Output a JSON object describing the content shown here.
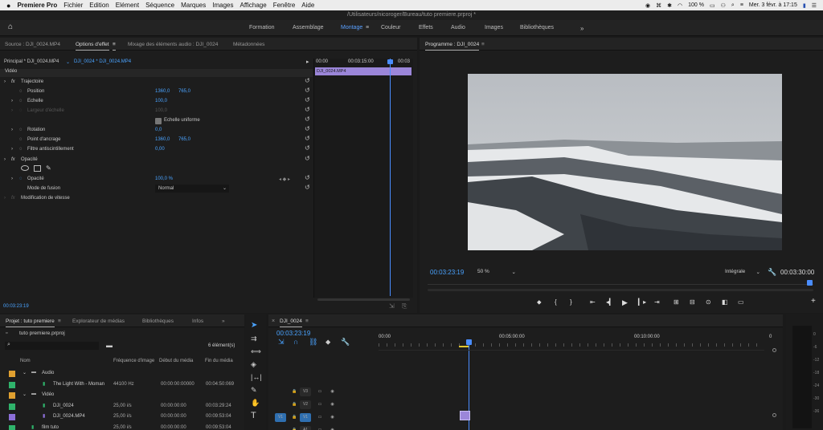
{
  "menubar": {
    "app_name": "Premiere Pro",
    "items": [
      "Fichier",
      "Edition",
      "Elément",
      "Séquence",
      "Marques",
      "Images",
      "Affichage",
      "Fenêtre",
      "Aide"
    ],
    "battery": "100 %",
    "clock": "Mer. 3 févr. à 17:15"
  },
  "window_title": "/Utilisateurs/nicoroger/Bureau/tuto premiere.prproj *",
  "workspaces": [
    "Formation",
    "Assemblage",
    "Montage",
    "Couleur",
    "Effets",
    "Audio",
    "Images",
    "Bibliothèques"
  ],
  "source_panel": {
    "tabs": [
      "Source : DJI_0024.MP4",
      "Options d'effet",
      "Mixage des éléments audio : DJI_0024",
      "Métadonnées"
    ],
    "clip_path": "Principal * DJI_0024.MP4",
    "clip_link": "DJI_0024 * DJI_0024.MP4",
    "mini_tl_start": "00:00",
    "mini_tl_mid": "00:03:15:00",
    "mini_tl_end": "00:03",
    "mini_clip": "DJI_0024.MP4",
    "section_video": "Vidéo",
    "motion": "Trajectoire",
    "position_label": "Position",
    "position_x": "1360,0",
    "position_y": "765,0",
    "scale_label": "Echelle",
    "scale_val": "100,0",
    "scale_width_label": "Largeur d'échelle",
    "scale_width_val": "100,0",
    "uniform_scale": "Echelle uniforme",
    "rotation_label": "Rotation",
    "rotation_val": "0,0",
    "anchor_label": "Point d'ancrage",
    "anchor_x": "1360,0",
    "anchor_y": "765,0",
    "antiflicker_label": "Filtre antiscintillement",
    "antiflicker_val": "0,00",
    "opacity_group": "Opacité",
    "opacity_label": "Opacité",
    "opacity_val": "100,0 %",
    "blend_label": "Mode de fusion",
    "blend_val": "Normal",
    "speed": "Modification de vitesse",
    "timecode": "00:03:23:19"
  },
  "program_panel": {
    "title": "Programme : DJI_0024",
    "timecode": "00:03:23:19",
    "zoom": "50 %",
    "quality": "Intégrale",
    "duration": "00:03:30:00"
  },
  "project_panel": {
    "tabs": [
      "Projet : tuto premiere",
      "Explorateur de médias",
      "Bibliothèques",
      "Infos"
    ],
    "project_file": "tuto premiere.prproj",
    "count": "6 élément(s)",
    "columns": [
      "Nom",
      "Fréquence d'image",
      "Début du média",
      "Fin du média"
    ],
    "items": [
      {
        "name": "Audio",
        "fps": "",
        "start": "",
        "end": "",
        "color": "#e0a030",
        "folder": true,
        "indent": 0
      },
      {
        "name": "The Light With - Moman",
        "fps": "44100  Hz",
        "start": "00:00:00:00000",
        "end": "00:04:50:069",
        "color": "#2fb36b",
        "folder": false,
        "indent": 1
      },
      {
        "name": "Vidéo",
        "fps": "",
        "start": "",
        "end": "",
        "color": "#e0a030",
        "folder": true,
        "indent": 0
      },
      {
        "name": "DJI_0024",
        "fps": "25,00 i/s",
        "start": "00:00:00:00",
        "end": "00:03:29:24",
        "color": "#2fb36b",
        "folder": false,
        "indent": 1
      },
      {
        "name": "DJI_0024.MP4",
        "fps": "25,00 i/s",
        "start": "00:00:00:00",
        "end": "00:09:53:04",
        "color": "#8c6fd8",
        "folder": false,
        "indent": 1
      },
      {
        "name": "film tuto",
        "fps": "25,00 i/s",
        "start": "00:00:00:00",
        "end": "00:09:53:04",
        "color": "#2fb36b",
        "folder": false,
        "indent": 0
      }
    ]
  },
  "timeline_panel": {
    "tab": "DJI_0024",
    "timecode": "00:03:23:19",
    "ruler": [
      "00:00",
      "00:05:00:00",
      "00:10:00:00",
      "0"
    ],
    "tracks": [
      "V3",
      "V2",
      "V1",
      "A1"
    ],
    "source_patch": "V1"
  },
  "vu_meter": [
    "0",
    "-6",
    "-12",
    "-18",
    "-24",
    "-30",
    "-36"
  ],
  "colors": {
    "accent": "#4aa3ff",
    "clip_purple": "#9b86d9",
    "playhead": "#4a8dff"
  }
}
